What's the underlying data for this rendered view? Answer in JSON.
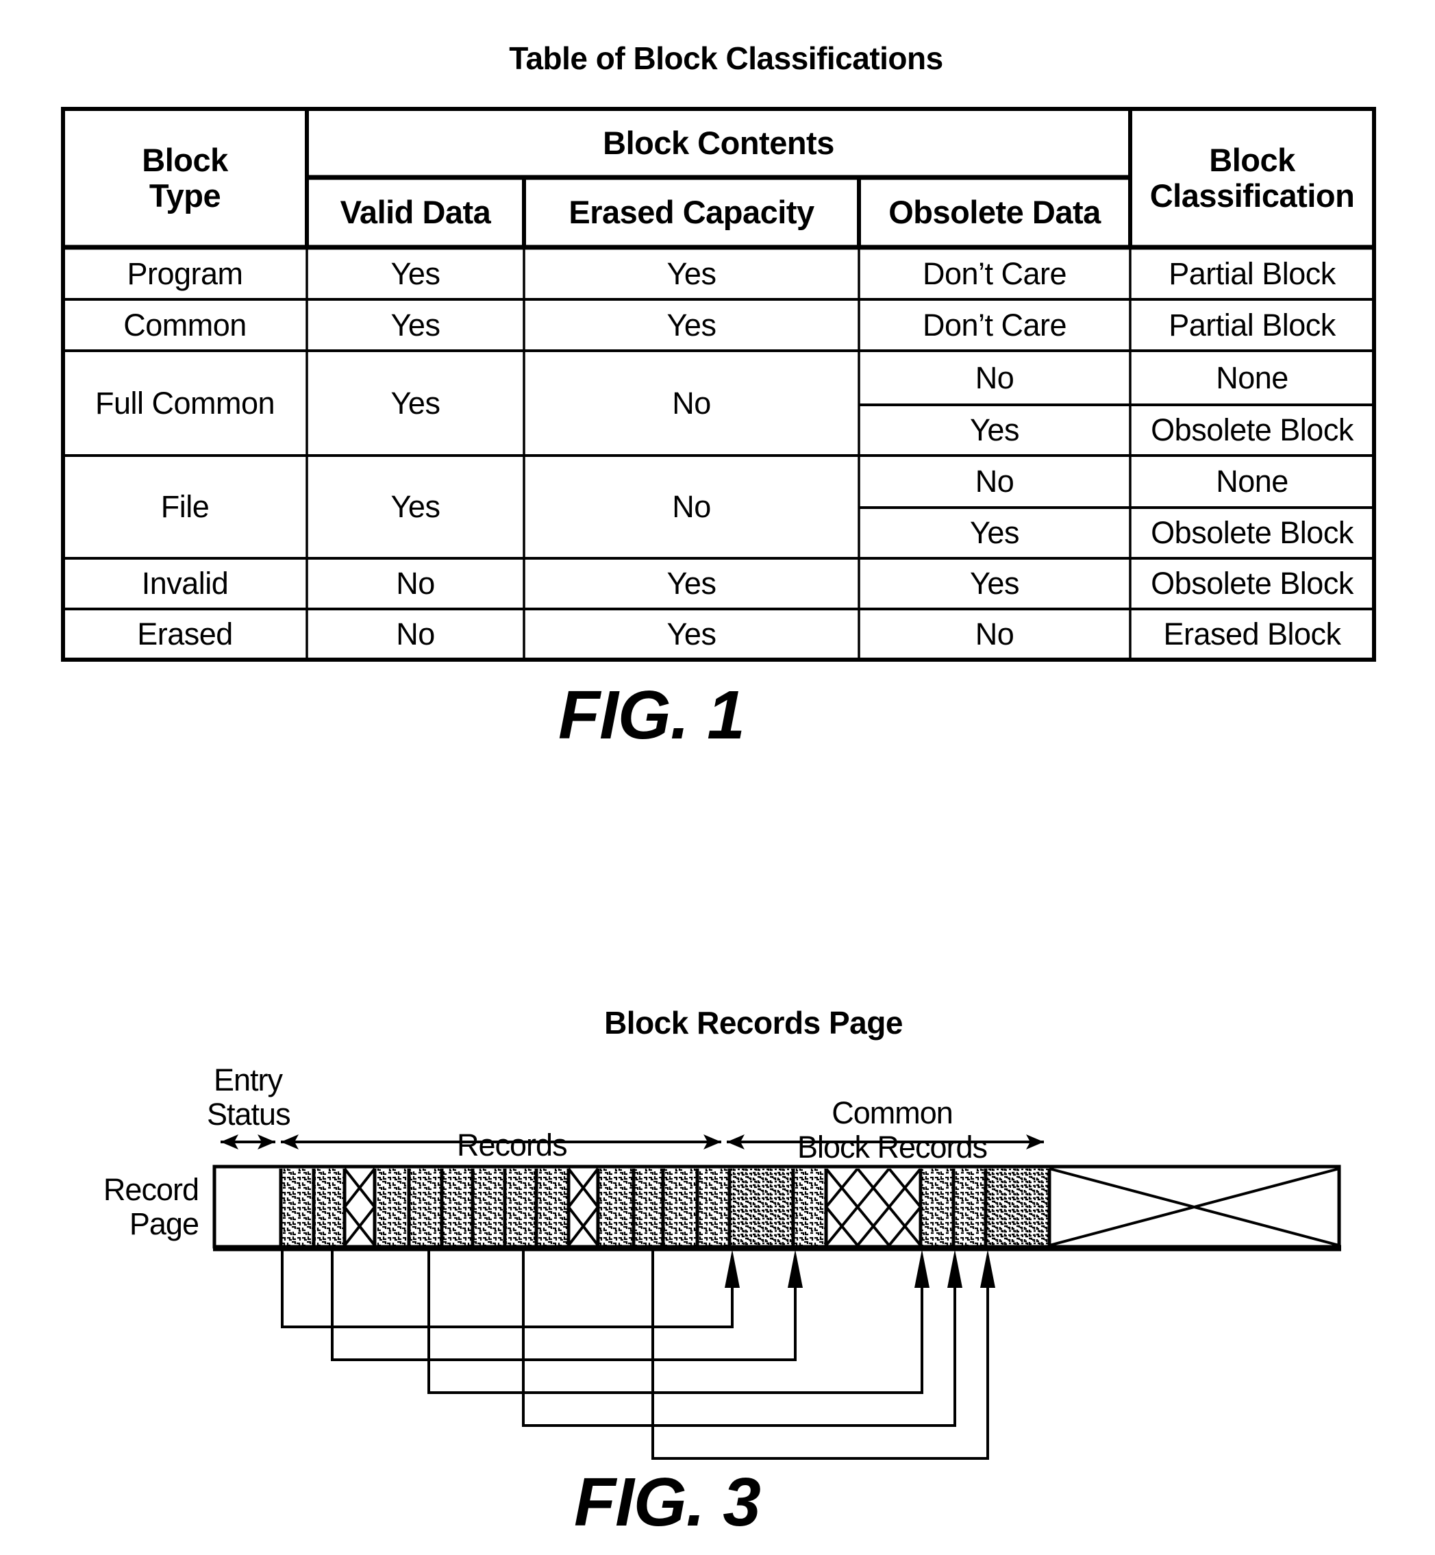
{
  "fig1": {
    "title": "Table of Block Classifications",
    "caption": "FIG. 1",
    "headers": {
      "block_type": "Block Type",
      "block_type_line1": "Block",
      "block_type_line2": "Type",
      "block_contents": "Block Contents",
      "valid_data": "Valid Data",
      "erased_capacity": "Erased Capacity",
      "obsolete_data": "Obsolete Data",
      "block_classification_line1": "Block",
      "block_classification_line2": "Classification"
    },
    "rows": [
      {
        "block_type": "Program",
        "valid_data": "Yes",
        "erased_capacity": "Yes",
        "cases": [
          {
            "obsolete_data": "Don’t Care",
            "classification": "Partial Block"
          }
        ]
      },
      {
        "block_type": "Common",
        "valid_data": "Yes",
        "erased_capacity": "Yes",
        "cases": [
          {
            "obsolete_data": "Don’t Care",
            "classification": "Partial Block"
          }
        ]
      },
      {
        "block_type": "Full Common",
        "valid_data": "Yes",
        "erased_capacity": "No",
        "cases": [
          {
            "obsolete_data": "No",
            "classification": "None"
          },
          {
            "obsolete_data": "Yes",
            "classification": "Obsolete Block"
          }
        ]
      },
      {
        "block_type": "File",
        "valid_data": "Yes",
        "erased_capacity": "No",
        "cases": [
          {
            "obsolete_data": "No",
            "classification": "None"
          },
          {
            "obsolete_data": "Yes",
            "classification": "Obsolete Block"
          }
        ]
      },
      {
        "block_type": "Invalid",
        "valid_data": "No",
        "erased_capacity": "Yes",
        "cases": [
          {
            "obsolete_data": "Yes",
            "classification": "Obsolete Block"
          }
        ]
      },
      {
        "block_type": "Erased",
        "valid_data": "No",
        "erased_capacity": "Yes",
        "cases": [
          {
            "obsolete_data": "No",
            "classification": "Erased Block"
          }
        ]
      }
    ]
  },
  "fig3": {
    "title": "Block Records Page",
    "caption": "FIG. 3",
    "labels": {
      "record_page_line1": "Record",
      "record_page_line2": "Page",
      "entry_status_line1": "Entry",
      "entry_status_line2": "Status",
      "records": "Records",
      "common_line1": "Common",
      "common_line2": "Block Records"
    },
    "segments": [
      {
        "type": "entry-status"
      },
      {
        "type": "record"
      },
      {
        "type": "record"
      },
      {
        "type": "obsolete-record"
      },
      {
        "type": "record"
      },
      {
        "type": "record"
      },
      {
        "type": "record"
      },
      {
        "type": "record"
      },
      {
        "type": "record"
      },
      {
        "type": "record"
      },
      {
        "type": "obsolete-record"
      },
      {
        "type": "record"
      },
      {
        "type": "record"
      },
      {
        "type": "record"
      },
      {
        "type": "record"
      },
      {
        "type": "common-block-record"
      },
      {
        "type": "common-block-record"
      },
      {
        "type": "obsolete-common-block-record"
      },
      {
        "type": "common-block-record"
      },
      {
        "type": "common-block-record"
      },
      {
        "type": "common-block-record"
      },
      {
        "type": "erased-space"
      }
    ],
    "links": [
      {
        "from_record": 1,
        "to_common": 1
      },
      {
        "from_record": 2,
        "to_common": 2
      },
      {
        "from_record": 4,
        "to_common": 3
      },
      {
        "from_record": 7,
        "to_common": 4
      },
      {
        "from_record": 11,
        "to_common": 5
      }
    ]
  }
}
